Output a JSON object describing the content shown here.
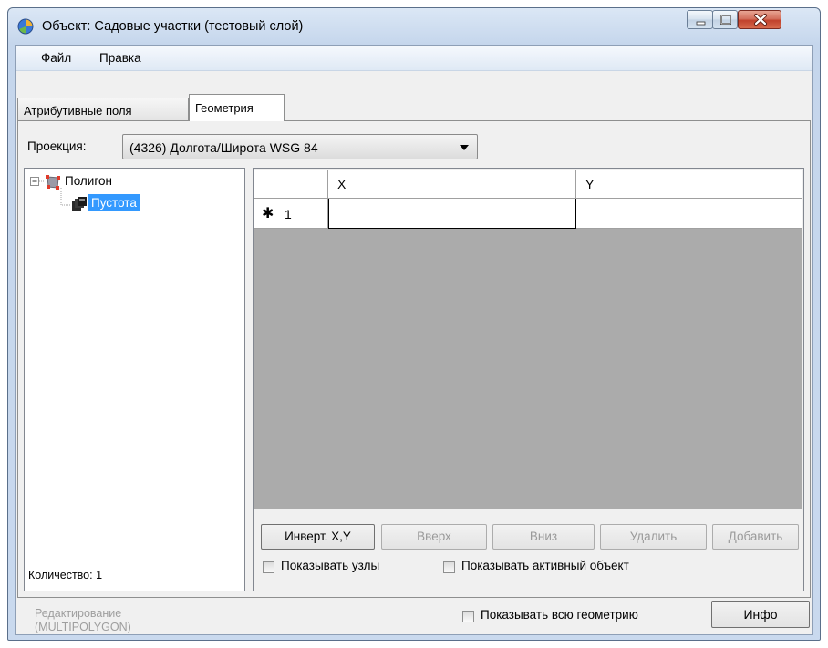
{
  "window": {
    "title": "Объект: Садовые участки (тестовый слой)"
  },
  "menu": {
    "file": "Файл",
    "edit": "Правка"
  },
  "tabs": [
    {
      "label": "Атрибутивные поля",
      "active": false
    },
    {
      "label": "Геометрия",
      "active": true
    }
  ],
  "projection": {
    "label": "Проекция:",
    "selected": "(4326) Долгота/Широта WSG 84"
  },
  "tree": {
    "root": "Полигон",
    "child": "Пустота",
    "count_label": "Количество: 1"
  },
  "grid": {
    "columns": [
      "X",
      "Y"
    ],
    "new_row_marker": "✱",
    "rows": [
      {
        "index": "1",
        "x": "",
        "y": ""
      }
    ]
  },
  "buttons": {
    "invert": "Инверт. X,Y",
    "up": "Вверх",
    "down": "Вниз",
    "delete": "Удалить",
    "add": "Добавить",
    "info": "Инфо"
  },
  "checkboxes": {
    "show_nodes": "Показывать узлы",
    "show_active": "Показывать активный объект",
    "show_all_geometry": "Показывать всю геометрию"
  },
  "status": {
    "line1": "Редактирование",
    "line2": "(MULTIPOLYGON)"
  },
  "colors": {
    "selection": "#3399ff",
    "grid_empty": "#ababab",
    "disabled_text": "#9a9a9a"
  }
}
